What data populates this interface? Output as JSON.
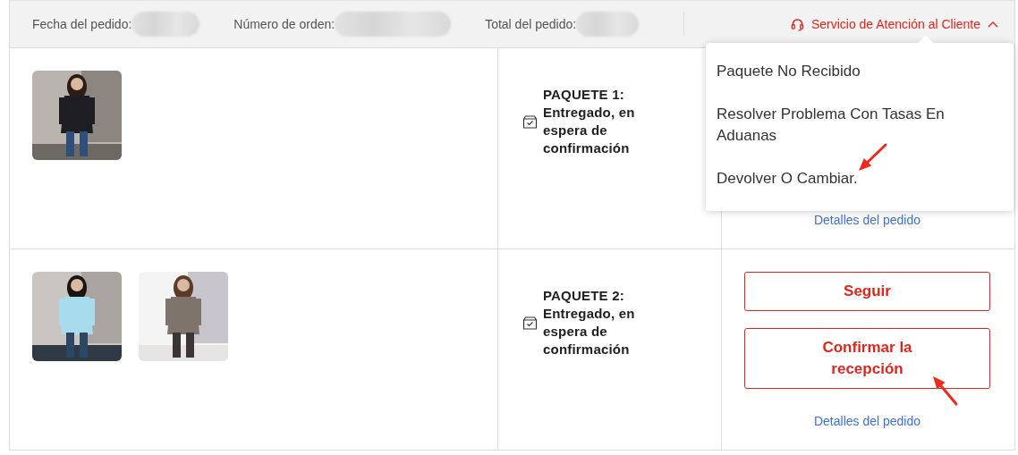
{
  "header": {
    "fields": [
      {
        "label": "Fecha del pedido:"
      },
      {
        "label": "Número de orden:"
      },
      {
        "label": "Total del pedido:"
      }
    ],
    "support": {
      "label": "Servicio de Atención al Cliente",
      "expanded": true
    }
  },
  "support_menu": {
    "items": [
      "Paquete No Recibido",
      "Resolver Problema Con Tasas En Aduanas",
      "Devolver O Cambiar."
    ]
  },
  "packages": [
    {
      "status": "PAQUETE 1: Entregado, en espera de confirmación",
      "products": [
        {
          "kind": "picture"
        }
      ],
      "details_link": "Detalles del pedido"
    },
    {
      "status": "PAQUETE 2: Entregado, en espera de confirmación",
      "products": [
        {
          "kind": "picture"
        },
        {
          "kind": "picture"
        }
      ],
      "buttons": [
        "Seguir",
        "Confirmar la recepción"
      ],
      "details_link": "Detalles del pedido"
    }
  ]
}
